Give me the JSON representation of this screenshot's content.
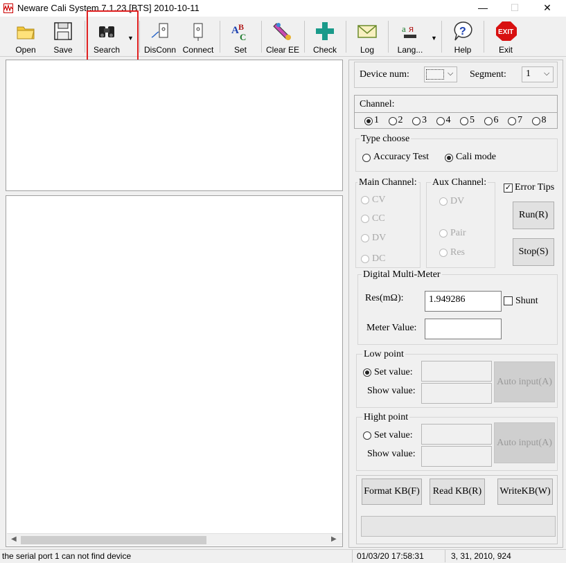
{
  "window": {
    "title": "Neware Cali System 7.1.23     [BTS] 2010-10-11",
    "minimize": "—",
    "maximize": "☐",
    "close": "✕"
  },
  "toolbar": {
    "open": "Open",
    "save": "Save",
    "search": "Search",
    "disconn": "DisConn",
    "connect": "Connect",
    "set": "Set",
    "clear_ee": "Clear EE",
    "check": "Check",
    "log": "Log",
    "language": "Lang...",
    "help": "Help",
    "exit": "Exit",
    "exit_icon_text": "EXIT"
  },
  "device": {
    "label": "Device num:",
    "value": "",
    "segment_label": "Segment:",
    "segment_value": "1"
  },
  "channel": {
    "title": "Channel:",
    "options": [
      "1",
      "2",
      "3",
      "4",
      "5",
      "6",
      "7",
      "8"
    ],
    "selected": 0
  },
  "type_choose": {
    "title": "Type choose",
    "accuracy_test": "Accuracy Test",
    "cali_mode": "Cali mode",
    "selected": "cali_mode"
  },
  "main_channel": {
    "title": "Main Channel:",
    "options": [
      "CV",
      "CC",
      "DV",
      "DC"
    ]
  },
  "aux_channel": {
    "title": "Aux Channel:",
    "options": [
      "DV",
      "Pair",
      "Res"
    ]
  },
  "error_tips": {
    "label": "Error Tips",
    "checked": true
  },
  "run_button": "Run(R)",
  "stop_button": "Stop(S)",
  "dmm": {
    "title": "Digital Multi-Meter",
    "res_label": "Res(mΩ):",
    "res_value": "1.949286",
    "shunt_label": "Shunt",
    "meter_label": "Meter Value:",
    "meter_value": ""
  },
  "low_point": {
    "title": "Low point",
    "set_label": "Set value:",
    "show_label": "Show value:",
    "auto_input": "Auto input(A)",
    "selected": true
  },
  "high_point": {
    "title": "Hight point",
    "set_label": "Set value:",
    "show_label": "Show value:",
    "auto_input": "Auto input(A)",
    "selected": false
  },
  "kb": {
    "format": "Format KB(F)",
    "read": "Read KB(R)",
    "write": "WriteKB(W)"
  },
  "status": {
    "message": "the serial port 1 can not find device",
    "datetime": "01/03/20 17:58:31",
    "version": "3, 31, 2010, 924"
  },
  "colors": {
    "highlight": "#e02020",
    "check_cross": "#1a9a8a",
    "exit_red": "#d81010"
  }
}
